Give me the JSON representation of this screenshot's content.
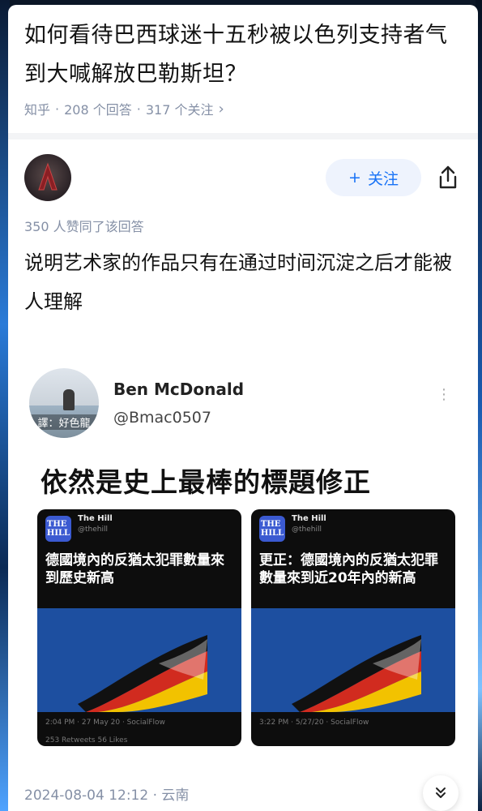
{
  "question": {
    "title": "如何看待巴西球迷十五秒被以色列支持者气到大喊解放巴勒斯坦？",
    "source": "知乎",
    "answers": "208 个回答",
    "follows": "317 个关注"
  },
  "answer": {
    "follow_label": "关注",
    "likes": "350 人赞同了该回答",
    "text": "说明艺术家的作品只有在通过时间沉淀之后才能被人理解"
  },
  "tweet": {
    "name": "Ben McDonald",
    "handle": "@Bmac0507",
    "avatar_watermark": "譯：好色龍",
    "caption": "依然是史上最棒的標題修正",
    "shots": [
      {
        "source": "The Hill",
        "handle": "@thehill",
        "headline": "德國境內的反猶太犯罪數量來到歷史新高",
        "time": "2:04 PM · 27 May 20 · SocialFlow",
        "stats": "253 Retweets   56 Likes"
      },
      {
        "source": "The Hill",
        "handle": "@thehill",
        "headline": "更正：德國境內的反猶太犯罪數量來到近20年內的新高",
        "time": "3:22 PM · 5/27/20 · SocialFlow",
        "stats": ""
      }
    ]
  },
  "footer": {
    "timestamp": "2024-08-04 12:12 · 云南"
  },
  "colors": {
    "accent": "#1772f6",
    "meta": "#8590a6"
  }
}
